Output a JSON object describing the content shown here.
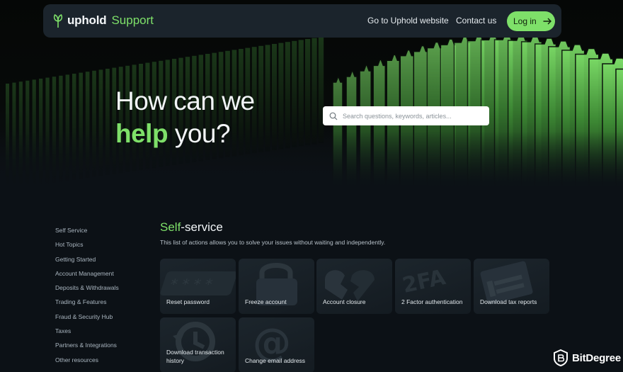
{
  "header": {
    "logo_word": "uphold",
    "logo_sub": "Support",
    "nav_website": "Go to Uphold website",
    "nav_contact": "Contact us",
    "login_label": "Log in"
  },
  "hero": {
    "line1": "How can we",
    "line2_highlight": "help",
    "line2_rest": " you?",
    "search_placeholder": "Search questions, keywords, articles..."
  },
  "sidebar": {
    "items": [
      {
        "label": "Self Service"
      },
      {
        "label": "Hot Topics"
      },
      {
        "label": "Getting Started"
      },
      {
        "label": "Account Management"
      },
      {
        "label": "Deposits & Withdrawals"
      },
      {
        "label": "Trading & Features"
      },
      {
        "label": "Fraud & Security Hub"
      },
      {
        "label": "Taxes"
      },
      {
        "label": "Partners & Integrations"
      },
      {
        "label": "Other resources"
      }
    ]
  },
  "self_service": {
    "title_highlight": "Self",
    "title_rest": "-service",
    "description": "This list of actions allows you to solve your issues without waiting and independently.",
    "cards": [
      {
        "label": "Reset password",
        "icon": "password-icon"
      },
      {
        "label": "Freeze account",
        "icon": "padlock-icon"
      },
      {
        "label": "Account closure",
        "icon": "broken-heart-icon"
      },
      {
        "label": "2 Factor authentication",
        "icon": "2fa-icon"
      },
      {
        "label": "Download tax reports",
        "icon": "tax-report-icon"
      },
      {
        "label": "Download transaction history",
        "icon": "history-icon"
      },
      {
        "label": "Change email address",
        "icon": "at-sign-icon"
      }
    ]
  },
  "watermark": {
    "text": "BitDegree"
  },
  "colors": {
    "accent": "#7ee069",
    "background": "#0c1116",
    "header_bg": "#1b242c",
    "card_bg": "#1a232a"
  }
}
